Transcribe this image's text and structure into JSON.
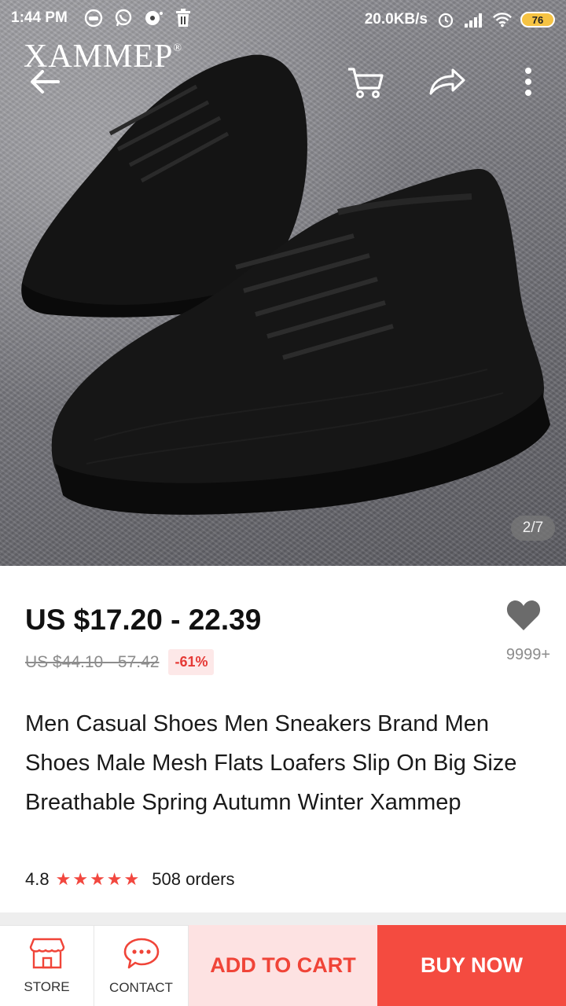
{
  "status_bar": {
    "time": "1:44 PM",
    "network_speed": "20.0KB/s",
    "battery": "76",
    "icons": [
      "imo-icon",
      "whatsapp-icon",
      "messenger-icon",
      "delete-icon",
      "alarm-icon",
      "signal-icon",
      "wifi-icon",
      "battery-icon"
    ]
  },
  "gallery": {
    "brand_watermark": "XAMMEP",
    "brand_mark": "®",
    "counter": "2/7"
  },
  "toolbar": {
    "icons": [
      "back-arrow-icon",
      "cart-icon",
      "share-icon",
      "more-vertical-icon"
    ]
  },
  "product": {
    "price": "US $17.20 - 22.39",
    "original_price": "US $44.10 - 57.42",
    "discount": "-61%",
    "wishlist_count": "9999+",
    "title": "Men Casual Shoes Men Sneakers Brand Men Shoes Male Mesh Flats Loafers Slip On Big Size Breathable Spring Autumn Winter Xammep",
    "rating": "4.8",
    "rating_stars": 5,
    "orders": "508 orders"
  },
  "bottom_bar": {
    "store_label": "STORE",
    "contact_label": "CONTACT",
    "add_to_cart_label": "ADD TO CART",
    "buy_now_label": "BUY NOW"
  },
  "colors": {
    "accent": "#f44b40",
    "accent_light": "#fde2e2",
    "discount_bg": "#fde8e8",
    "muted_text": "#8c8c8c"
  }
}
